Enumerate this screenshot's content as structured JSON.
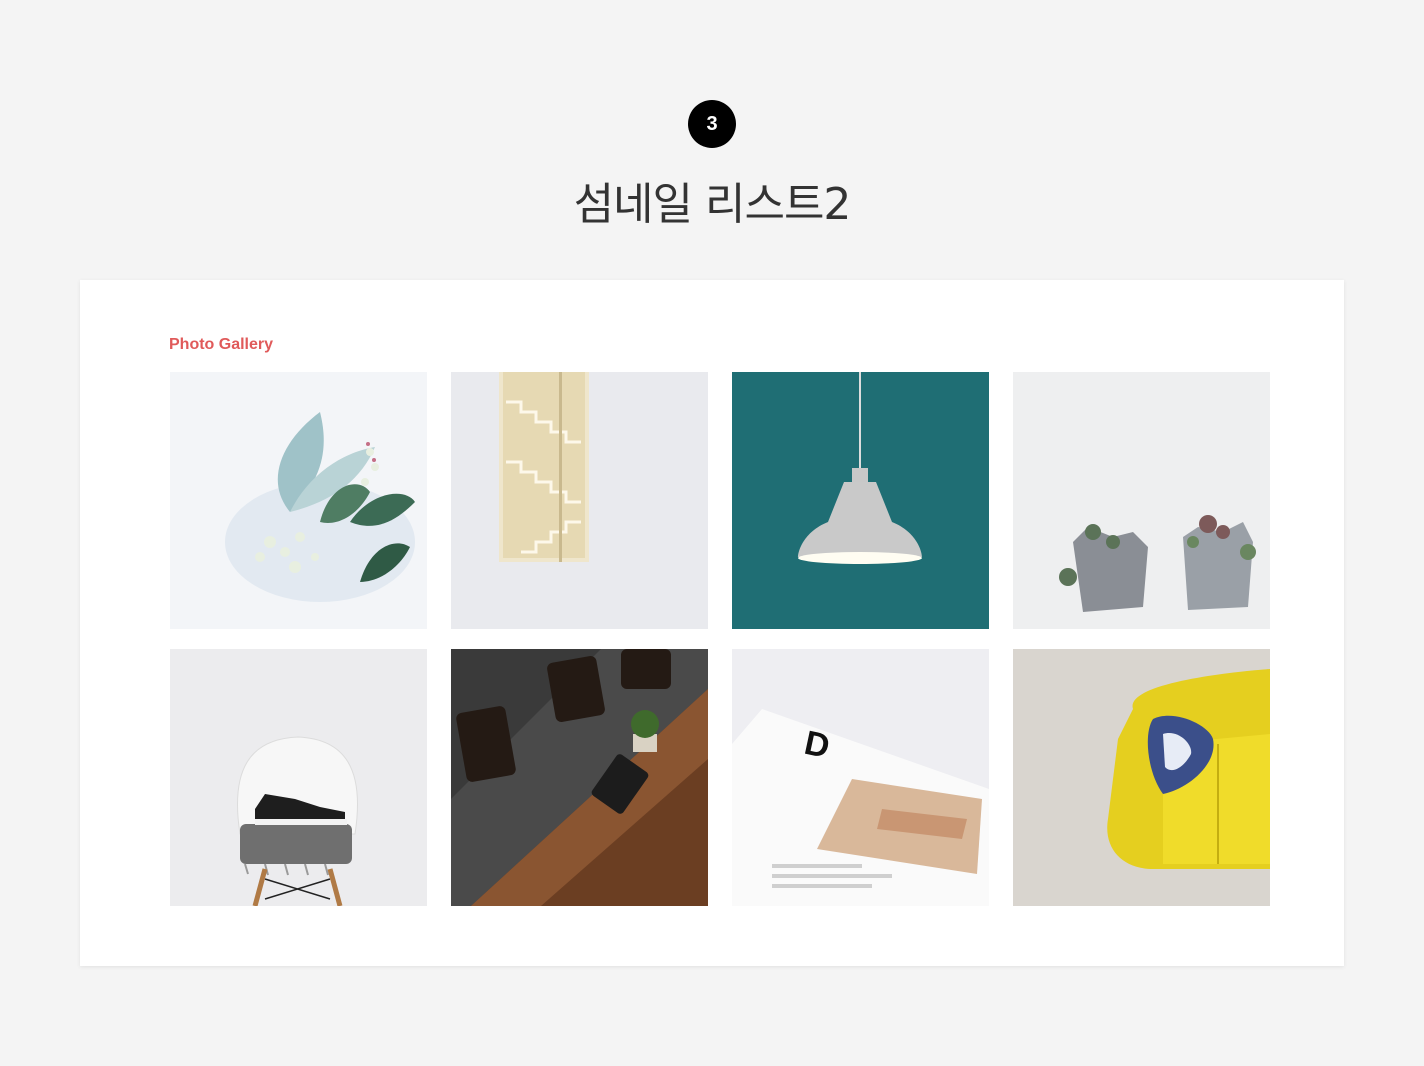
{
  "step": {
    "number": "3"
  },
  "header": {
    "title": "섬네일 리스트2"
  },
  "gallery": {
    "label": "Photo Gallery",
    "accent_color": "#e05a5a",
    "items": [
      {
        "subject": "white-flowers-leaves"
      },
      {
        "subject": "staircase-window"
      },
      {
        "subject": "pendant-lamp-teal-wall"
      },
      {
        "subject": "succulent-pots"
      },
      {
        "subject": "sneakers-on-white-chair"
      },
      {
        "subject": "wooden-table-chairs"
      },
      {
        "subject": "magazine-page-letter-d"
      },
      {
        "subject": "yellow-sofa-pillow"
      }
    ]
  }
}
